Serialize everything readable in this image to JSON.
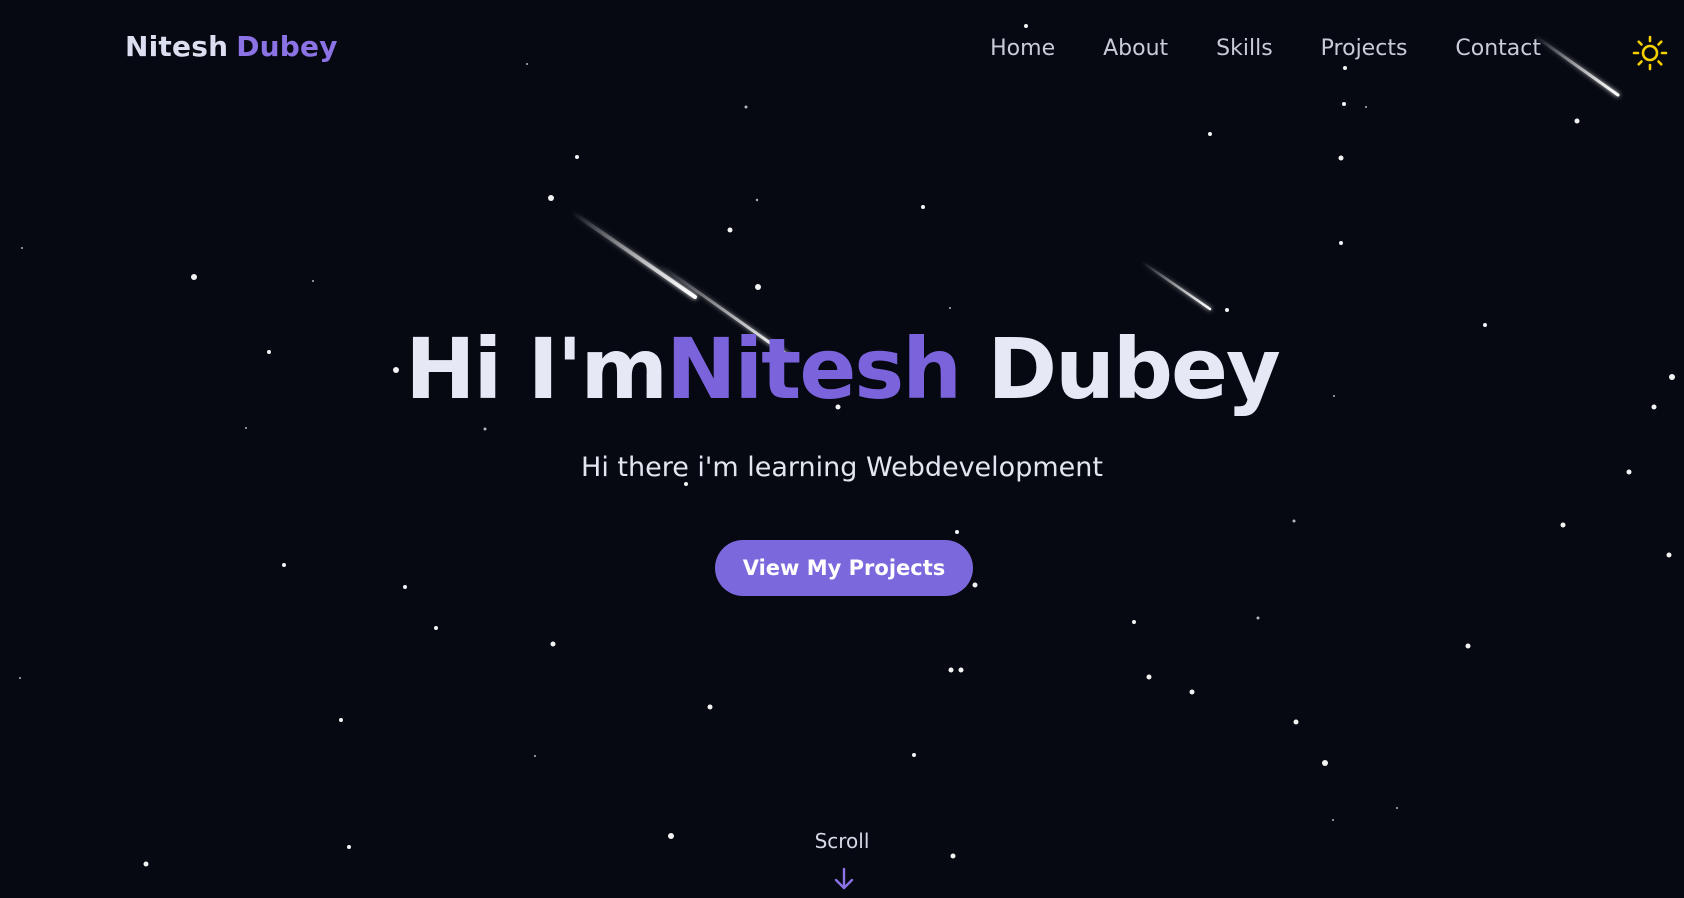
{
  "brand": {
    "first": "Nitesh",
    "last": "Dubey"
  },
  "nav": {
    "items": [
      "Home",
      "About",
      "Skills",
      "Projects",
      "Contact"
    ],
    "theme_icon": "sun-icon"
  },
  "hero": {
    "prefix": "Hi I'm",
    "accent": "Nitesh",
    "rest": "Dubey",
    "subtitle": "Hi there i'm learning Webdevelopment",
    "cta_label": "View My Projects"
  },
  "scroll": {
    "label": "Scroll",
    "icon": "arrow-down-icon"
  },
  "colors": {
    "background": "#060912",
    "accent": "#7b63dc",
    "button": "#7a68dc",
    "sun": "#f5d000",
    "text": "#e6e9f5"
  }
}
